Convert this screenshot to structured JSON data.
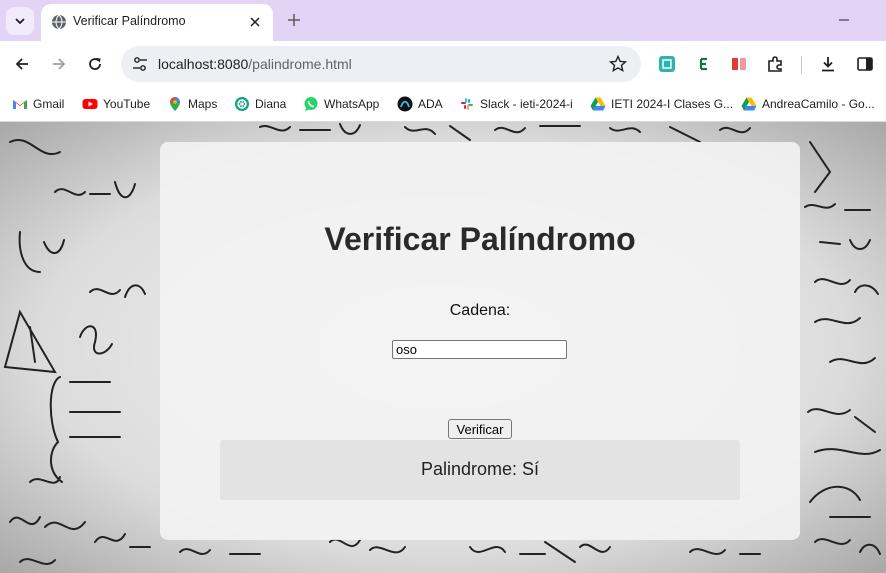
{
  "browser": {
    "tab": {
      "title": "Verificar Palíndromo"
    },
    "url": {
      "host": "localhost:8080",
      "path": "/palindrome.html"
    },
    "bookmarks": [
      {
        "label": "Gmail",
        "icon": "gmail-icon"
      },
      {
        "label": "YouTube",
        "icon": "youtube-icon"
      },
      {
        "label": "Maps",
        "icon": "maps-icon"
      },
      {
        "label": "Diana",
        "icon": "chatgpt-icon"
      },
      {
        "label": "WhatsApp",
        "icon": "whatsapp-icon"
      },
      {
        "label": "ADA",
        "icon": "ada-icon"
      },
      {
        "label": "Slack - ieti-2024-i",
        "icon": "slack-icon"
      },
      {
        "label": "IETI 2024-I Clases G...",
        "icon": "google-drive-icon"
      },
      {
        "label": "AndreaCamilo - Go...",
        "icon": "google-drive-icon"
      }
    ],
    "colors": {
      "tabstrip": "#e3d3f4",
      "omnibox": "#eceff4"
    }
  },
  "page": {
    "heading": "Verificar Palíndromo",
    "input_label": "Cadena:",
    "input_value": "oso",
    "button_label": "Verificar",
    "result": "Palindrome: Sí"
  }
}
